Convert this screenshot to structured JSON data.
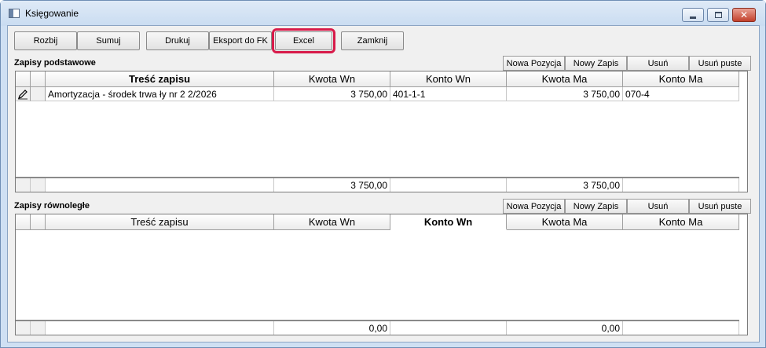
{
  "window": {
    "title": "Księgowanie",
    "controls": {
      "minimize": "minimize-icon",
      "maximize": "maximize-icon",
      "close": "close-icon"
    }
  },
  "toolbar": {
    "buttons": [
      "Rozbij",
      "Sumuj",
      "Drukuj",
      "Eksport do FK",
      "Excel",
      "Zamknij"
    ]
  },
  "podstawowe": {
    "label": "Zapisy podstawowe",
    "actions": [
      "Nowa Pozycja",
      "Nowy Zapis",
      "Usuń",
      "Usuń puste"
    ],
    "columns": [
      "Treść zapisu",
      "Kwota Wn",
      "Konto Wn",
      "Kwota Ma",
      "Konto Ma"
    ],
    "rows": [
      {
        "tresc": "Amortyzacja - środek trwa ły nr 2 2/2026",
        "kwota_wn": "3 750,00",
        "konto_wn": "401-1-1",
        "kwota_ma": "3 750,00",
        "konto_ma": "070-4",
        "row_icon": "pencil-icon"
      }
    ],
    "totals": {
      "kwota_wn": "3 750,00",
      "kwota_ma": "3 750,00"
    }
  },
  "rownolegle": {
    "label": "Zapisy równoległe",
    "actions": [
      "Nowa Pozycja",
      "Nowy Zapis",
      "Usuń",
      "Usuń puste"
    ],
    "columns": [
      "Treść zapisu",
      "Kwota Wn",
      "Konto Wn",
      "Kwota Ma",
      "Konto Ma"
    ],
    "rows": [],
    "totals": {
      "kwota_wn": "0,00",
      "kwota_ma": "0,00"
    }
  },
  "colors": {
    "highlight": "#d81b4a",
    "titlebar": "#cfe0f3"
  }
}
